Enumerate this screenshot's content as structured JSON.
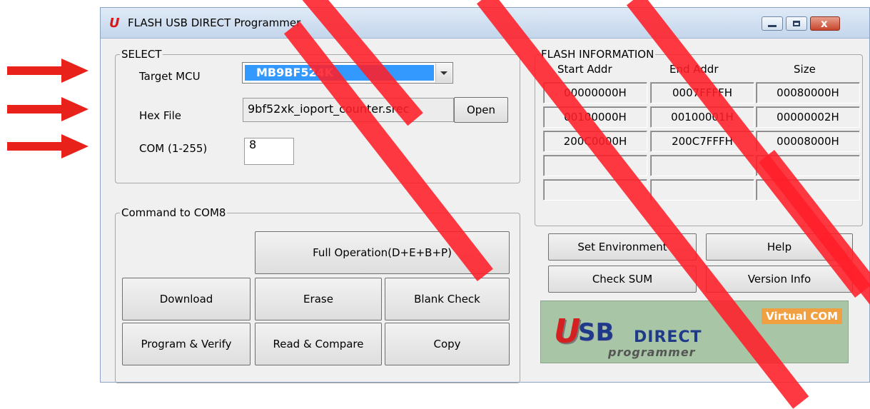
{
  "colors": {
    "arrow": "#e8211a",
    "window_bg": "#f0f0f0",
    "panel": "#f0f0f0",
    "accent_select": "#3399ff",
    "watermark": "#ff1e28"
  },
  "window": {
    "title": "FLASH USB DIRECT Programmer",
    "icon": "u-logo-icon",
    "close_glyph": "x"
  },
  "select": {
    "legend": "SELECT",
    "target_mcu_label": "Target MCU",
    "target_mcu_value": "MB9BF524K",
    "hex_file_label": "Hex File",
    "hex_file_value": "9bf52xk_ioport_counter.srec",
    "open_button": "Open",
    "com_label": "COM (1-255)",
    "com_value": "8"
  },
  "flash_info": {
    "legend": "FLASH INFORMATION",
    "columns": [
      "Start Addr",
      "End Addr",
      "Size"
    ],
    "rows": [
      [
        "00000000H",
        "0007FFFFH",
        "00080000H"
      ],
      [
        "00100000H",
        "00100001H",
        "00000002H"
      ],
      [
        "200C0000H",
        "200C7FFFH",
        "00008000H"
      ],
      [
        "",
        "",
        ""
      ],
      [
        "",
        "",
        ""
      ]
    ]
  },
  "command": {
    "legend": "Command to COM8",
    "full_operation": "Full Operation(D+E+B+P)",
    "download": "Download",
    "erase": "Erase",
    "blank_check": "Blank Check",
    "program_verify": "Program & Verify",
    "read_compare": "Read & Compare",
    "copy": "Copy"
  },
  "side_buttons": {
    "set_environment": "Set Environment",
    "help": "Help",
    "check_sum": "Check SUM",
    "version_info": "Version Info"
  },
  "banner": {
    "virtual_com": "Virtual COM",
    "logo_u": "U",
    "logo_sb": "SB",
    "logo_direct": "DIRECT",
    "logo_programmer": "programmer"
  }
}
